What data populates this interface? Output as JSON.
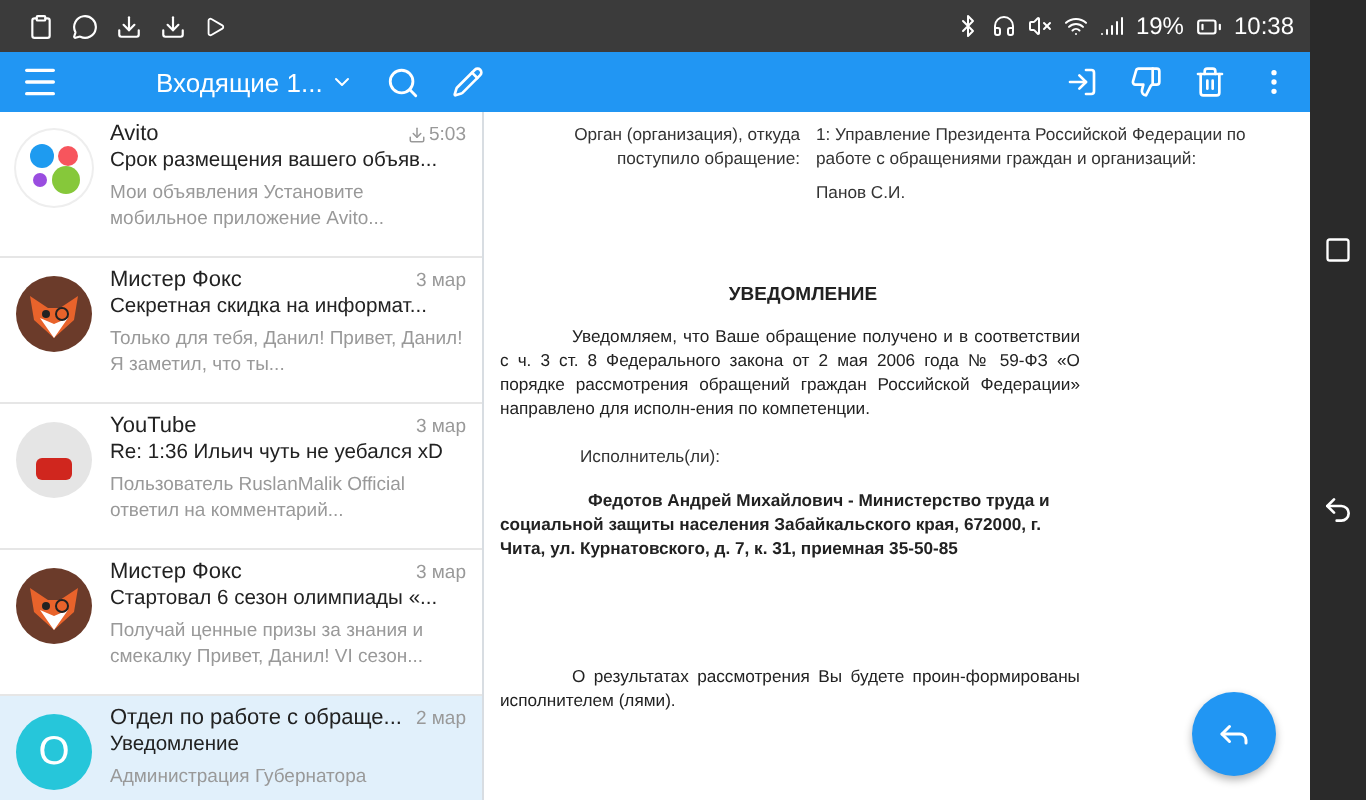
{
  "status_bar": {
    "battery": "19%",
    "time": "10:38"
  },
  "toolbar": {
    "folder": "Входящие 1..."
  },
  "messages": [
    {
      "kind": "avito",
      "sender": "Avito",
      "time": "5:03",
      "marked": true,
      "subject": "Срок размещения вашего объяв...",
      "preview": "Мои объявления Установите мобильное приложение Avito...",
      "selected": false
    },
    {
      "kind": "fox",
      "sender": "Мистер Фокс",
      "time": "3 мар",
      "marked": false,
      "subject": "Секретная скидка на информат...",
      "preview": "Только для тебя, Данил! Привет, Данил! Я заметил, что ты...",
      "selected": false
    },
    {
      "kind": "youtube",
      "sender": "YouTube",
      "time": "3 мар",
      "marked": false,
      "subject": "Re: 1:36 Ильич чуть не уебался xD",
      "preview": "Пользователь RuslanMalik Official ответил на комментарий...",
      "selected": false
    },
    {
      "kind": "fox",
      "sender": "Мистер Фокс",
      "time": "3 мар",
      "marked": false,
      "subject": "Стартовал 6 сезон олимпиады «...",
      "preview": "Получай ценные призы за знания и смекалку Привет, Данил! VI сезон...",
      "selected": false
    },
    {
      "kind": "letter",
      "letter": "О",
      "sender": "Отдел по работе с обраще...",
      "time": "2 мар",
      "marked": false,
      "subject": "Уведомление",
      "preview": "Администрация Губернатора",
      "selected": true
    }
  ],
  "document": {
    "org_label": "Орган (организация), откуда поступило обращение:",
    "org_value": "1: Управление Президента Российской Федерации по работе с обращениями граждан и организаций:",
    "signer": "Панов С.И.",
    "title": "УВЕДОМЛЕНИЕ",
    "notice": "Уведомляем, что Ваше обращение получено и в соответствии с ч. 3 ст. 8 Федерального закона от 2 мая 2006 года № 59-ФЗ «О порядке рассмотрения обращений граждан Российской Федерации» направлено для исполн-ения по компетенции.",
    "executor_label": "Исполнитель(ли):",
    "executor": "Федотов Андрей Михайлович - Министерство труда и социальной защиты населения Забайкальского края, 672000, г. Чита, ул. Курнатовского, д. 7, к. 31, приемная 35-50-85",
    "result": "О результатах рассмотрения Вы будете проин-формированы исполнителем (лями)."
  }
}
